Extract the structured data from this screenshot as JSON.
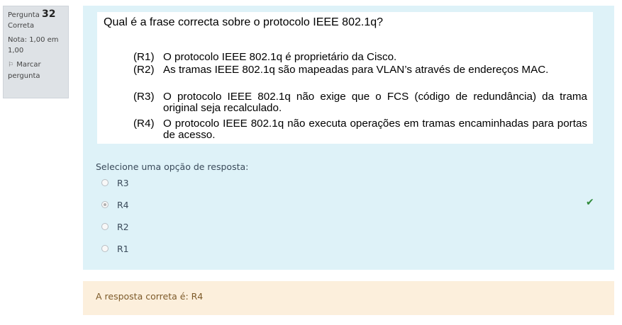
{
  "question_info": {
    "number_label": "Pergunta",
    "number": "32",
    "state": "Correta",
    "grade": "Nota: 1,00 em 1,00",
    "flag_label": "Marcar pergunta",
    "flag_icon": "flag-icon"
  },
  "question": {
    "title": "Qual é a frase correcta sobre o protocolo IEEE 802.1q?",
    "statements": [
      {
        "label": "(R1)",
        "text": "O protocolo IEEE 802.1q é proprietário da Cisco."
      },
      {
        "label": "(R2)",
        "text": "As tramas IEEE 802.1q são mapeadas para VLAN’s através de endereços MAC."
      },
      {
        "label": "(R3)",
        "text": "O protocolo IEEE 802.1q não exige que o FCS (código de redundância) da trama original seja recalculado."
      },
      {
        "label": "(R4)",
        "text": "O protocolo IEEE 802.1q não executa operações em tramas encaminhadas para portas de acesso."
      }
    ]
  },
  "answer": {
    "prompt": "Selecione uma opção de resposta:",
    "options": [
      {
        "label": "R3",
        "selected": false
      },
      {
        "label": "R4",
        "selected": true
      },
      {
        "label": "R2",
        "selected": false
      },
      {
        "label": "R1",
        "selected": false
      }
    ],
    "correct_icon": "check-icon",
    "correct_color": "#2f8a3a"
  },
  "feedback": {
    "text": "A resposta correta é: R4"
  },
  "colors": {
    "content_bg": "#def2f8",
    "info_bg": "#dee2e6",
    "feedback_bg": "#fcefdc"
  }
}
